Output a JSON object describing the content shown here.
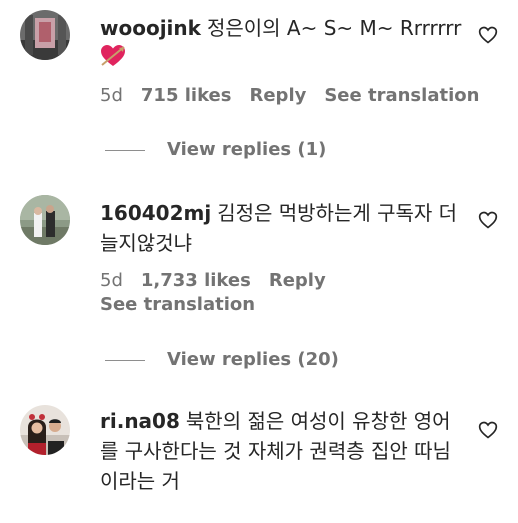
{
  "comments": [
    {
      "username": "wooojink",
      "text": "정은이의 A~ S~ M~ Rrrrrrr",
      "emoji": "heart-with-arrow",
      "time": "5d",
      "likes": "715 likes",
      "reply_label": "Reply",
      "translate_label": "See translation",
      "view_replies": "View replies (1)"
    },
    {
      "username": "160402mj",
      "text": "김정은 먹방하는게 구독자 더 늘지않것냐",
      "time": "5d",
      "likes": "1,733 likes",
      "reply_label": "Reply",
      "translate_label": "See translation",
      "view_replies": "View replies (20)"
    },
    {
      "username": "ri.na08",
      "text": "북한의 젊은 여성이 유창한 영어를 구사한다는 것 자체가 권력층 집안 따님이라는 거"
    }
  ],
  "colors": {
    "text": "#262626",
    "secondary": "#737373",
    "emoji_heart": "#e0245e"
  }
}
